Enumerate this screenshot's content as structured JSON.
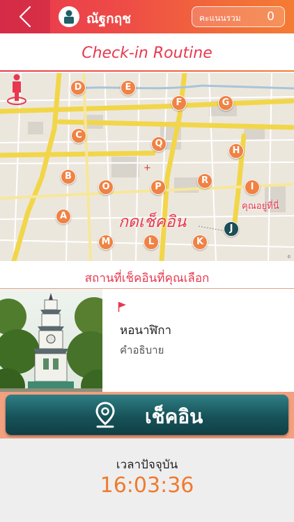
{
  "header": {
    "username": "ณัฐกฤช",
    "score_label": "คะแนนรวม",
    "score_value": "0"
  },
  "title": "Check-in Routine",
  "map": {
    "markers": [
      "D",
      "E",
      "F",
      "G",
      "C",
      "Q",
      "H",
      "B",
      "O",
      "P",
      "R",
      "I",
      "A",
      "M",
      "L",
      "K",
      "J"
    ],
    "checkin_label": "กดเช็คอิน",
    "you_here_label": "คุณอยู่ที่นี่"
  },
  "place": {
    "heading": "สถานที่เช็คอินที่คุณเลือก",
    "name": "หอนาฬิกา",
    "description": "คำอธิบาย"
  },
  "checkin_button": "เช็คอิน",
  "time": {
    "label": "เวลาปัจจุบัน",
    "value": "16:03:36"
  },
  "colors": {
    "accent": "#e8384f",
    "marker": "#f08243",
    "button": "#175258",
    "time": "#f07a2e"
  }
}
